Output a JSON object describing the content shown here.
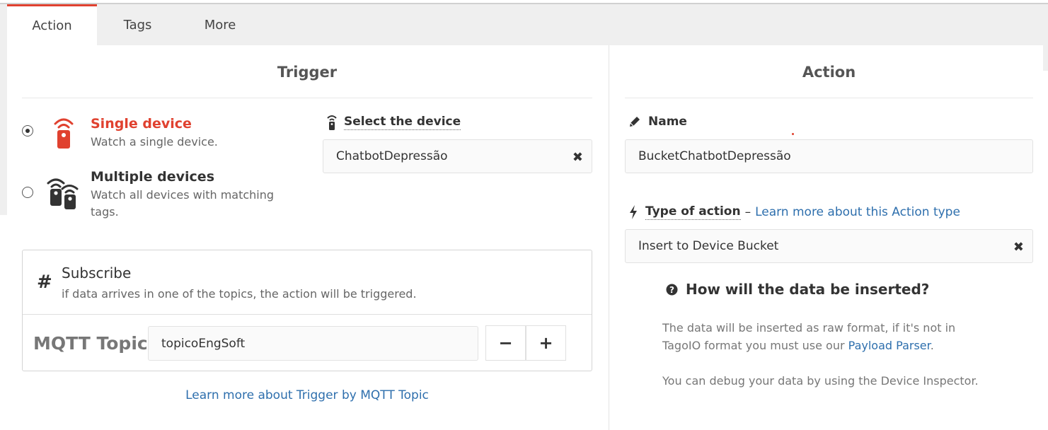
{
  "tabs": [
    {
      "label": "Action"
    },
    {
      "label": "Tags"
    },
    {
      "label": "More"
    }
  ],
  "trigger": {
    "title": "Trigger",
    "options": [
      {
        "title": "Single device",
        "desc": "Watch a single device.",
        "checked": true
      },
      {
        "title": "Multiple devices",
        "desc_line1": "Watch all devices with matching",
        "desc_line2": "tags.",
        "checked": false
      }
    ],
    "select_device_label": "Select the device",
    "selected_device": "ChatbotDepressão",
    "subscribe": {
      "symbol": "#",
      "title": "Subscribe",
      "desc": "if data arrives in one of the topics, the action will be triggered.",
      "topic_label": "MQTT Topic",
      "topic_value": "topicoEngSoft",
      "minus": "−",
      "plus": "+"
    },
    "learn_more": "Learn more about Trigger by MQTT Topic"
  },
  "action": {
    "title": "Action",
    "name_label": "Name",
    "name_value": "BucketChatbotDepressão",
    "type_label": "Type of action",
    "type_separator": "–",
    "type_link": "Learn more about this Action type",
    "type_value": "Insert to Device Bucket",
    "help_title": "How will the data be inserted?",
    "help_line1": "The data will be inserted as raw format, if it's not in",
    "help_line2_prefix": "TagoIO format you must use our ",
    "help_line2_link": "Payload Parser",
    "help_line2_suffix": ".",
    "help_line3": "You can debug your data by using the Device Inspector."
  },
  "colors": {
    "accent": "#e0412f",
    "link": "#2e6fad",
    "text": "#333333"
  },
  "icons": {
    "single_device": "remote-device-icon",
    "multiple_devices": "remote-devices-icon",
    "select_device": "remote-device-small-icon",
    "name": "pencil-icon",
    "type": "bolt-icon",
    "help": "question-circle-icon",
    "clear": "close-icon"
  }
}
